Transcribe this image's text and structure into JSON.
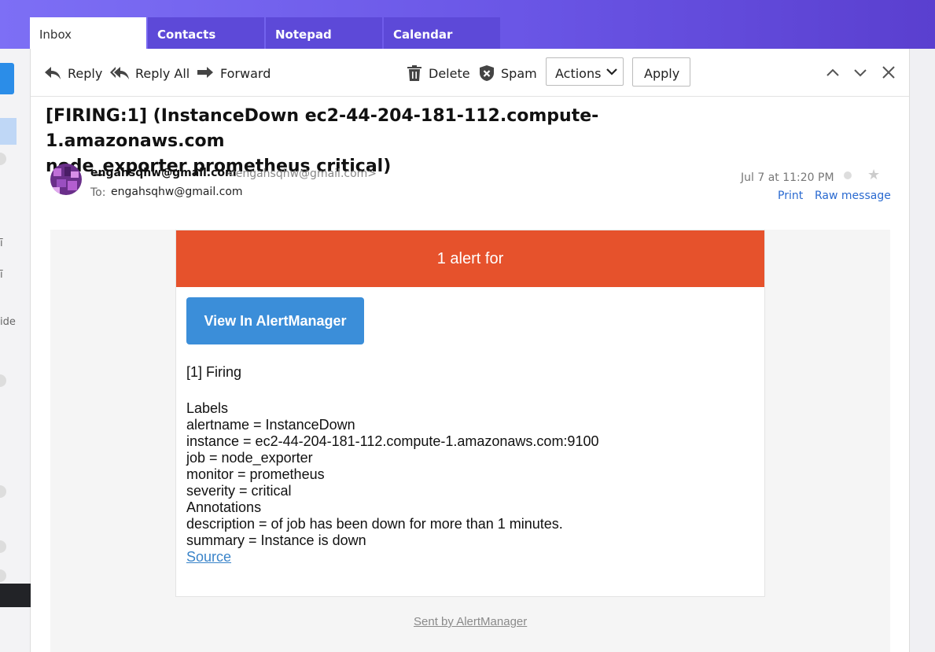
{
  "tabs": [
    "Inbox",
    "Contacts",
    "Notepad",
    "Calendar"
  ],
  "toolbar": {
    "reply": "Reply",
    "reply_all": "Reply All",
    "forward": "Forward",
    "delete": "Delete",
    "spam": "Spam",
    "actions": "Actions",
    "apply": "Apply"
  },
  "sidebar_fragments": {
    "g1": "ī",
    "g2": "ī",
    "g3": "ide"
  },
  "message": {
    "subject_line1": "[FIRING:1] (InstanceDown ec2-44-204-181-112.compute-1.amazonaws.com",
    "subject_line2": "node_exporter prometheus critical)",
    "from_name": "engahsqhw@gmail.com",
    "from_addr": "<engahsqhw@gmail.com>",
    "to_label": "To:",
    "to_addr": "engahsqhw@gmail.com",
    "date": "Jul 7 at 11:20 PM",
    "print": "Print",
    "raw": "Raw message"
  },
  "alert": {
    "header": "1 alert for",
    "button": "View In AlertManager",
    "firing": "[1] Firing",
    "labels_title": "Labels",
    "labels": [
      "alertname = InstanceDown",
      "instance = ec2-44-204-181-112.compute-1.amazonaws.com:9100",
      "job = node_exporter",
      "monitor = prometheus",
      "severity = critical"
    ],
    "annotations_title": "Annotations",
    "annotations": [
      "description = of job has been down for more than 1 minutes.",
      "summary = Instance is down"
    ],
    "source": "Source",
    "sent_by": "Sent by AlertManager"
  },
  "colors": {
    "header_red": "#e6522c",
    "button_blue": "#3b8ed9",
    "topbar_purple": "#6a56e6"
  }
}
